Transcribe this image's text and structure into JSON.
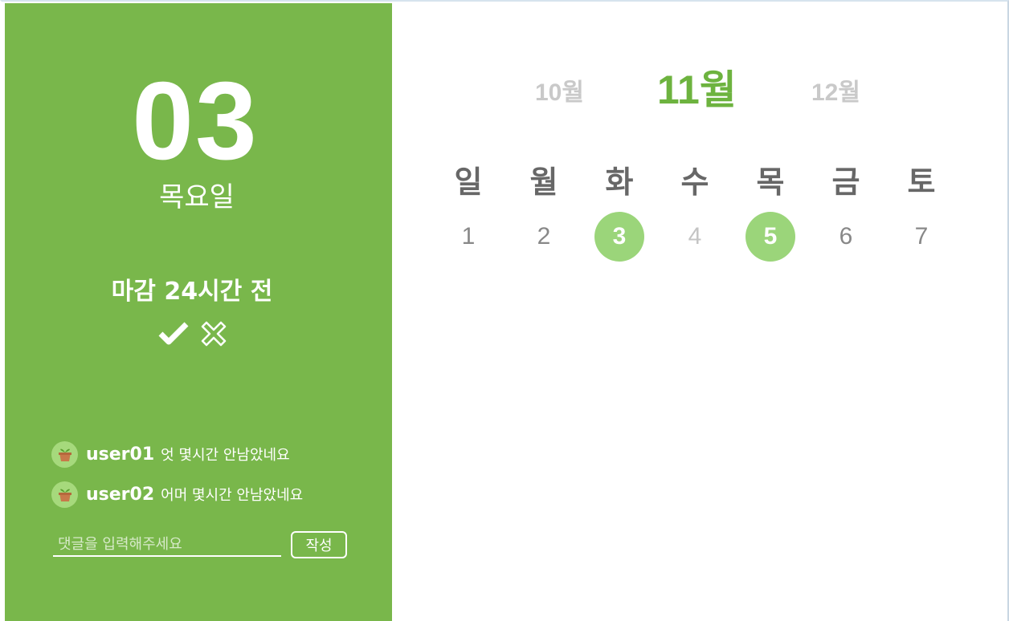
{
  "left": {
    "date_number": "03",
    "weekday": "목요일",
    "deadline": "마감 24시간 전",
    "comments": [
      {
        "user": "user01",
        "text": "엇 몇시간 안남았네요"
      },
      {
        "user": "user02",
        "text": "어머 몇시간 안남았네요"
      }
    ],
    "comment_placeholder": "댓글을 입력해주세요",
    "submit_label": "작성"
  },
  "calendar": {
    "prev_month": "10월",
    "current_month": "11월",
    "next_month": "12월",
    "weekdays": [
      "일",
      "월",
      "화",
      "수",
      "목",
      "금",
      "토"
    ],
    "days": [
      {
        "label": "1",
        "state": "normal"
      },
      {
        "label": "2",
        "state": "normal"
      },
      {
        "label": "3",
        "state": "marked"
      },
      {
        "label": "4",
        "state": "muted"
      },
      {
        "label": "5",
        "state": "marked"
      },
      {
        "label": "6",
        "state": "normal"
      },
      {
        "label": "7",
        "state": "normal"
      }
    ]
  },
  "colors": {
    "panel_green": "#79b74b",
    "accent_green": "#6db33f",
    "marked_circle": "#9bd57a"
  },
  "icons": {
    "confirm": "check-icon",
    "cancel": "x-icon",
    "avatar": "plant-pot-icon"
  }
}
